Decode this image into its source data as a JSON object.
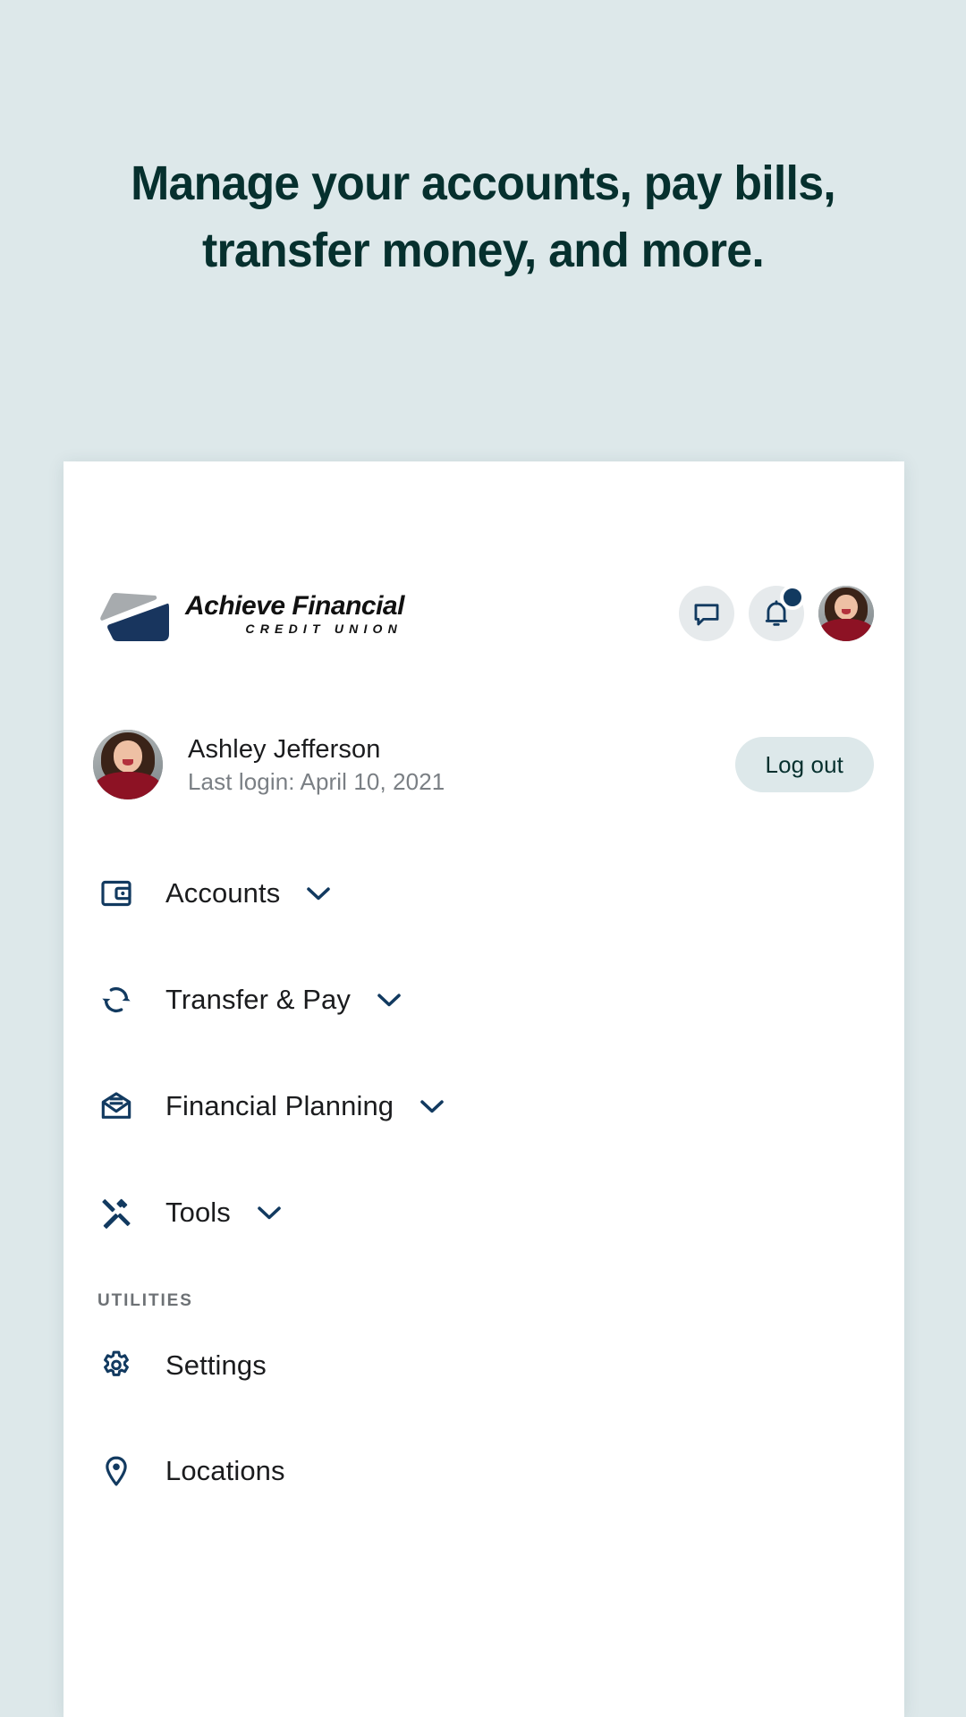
{
  "page": {
    "background_color": "#dde8ea",
    "headline_color": "#06302e",
    "accent_navy": "#123a60",
    "headline_line1": "Manage your accounts, pay bills,",
    "headline_line2": "transfer money, and more."
  },
  "card": {
    "background_color": "#ffffff",
    "brand": {
      "name": "Achieve Financial",
      "subtitle": "CREDIT UNION",
      "mark_gray": "#a7abae",
      "mark_navy": "#18355e"
    },
    "header_actions": [
      {
        "name": "messages-button",
        "icon": "chat-bubble-icon"
      },
      {
        "name": "notifications-button",
        "icon": "bell-icon",
        "has_badge": true
      },
      {
        "name": "profile-avatar-button",
        "icon": "avatar"
      }
    ],
    "user": {
      "name": "Ashley Jefferson",
      "last_login": "Last login: April 10, 2021",
      "logout_label": "Log out",
      "logout_bg": "#dde8ea"
    },
    "nav": {
      "items": [
        {
          "label": "Accounts",
          "icon": "wallet-icon",
          "has_caret": true
        },
        {
          "label": "Transfer & Pay",
          "icon": "sync-arrows-icon",
          "has_caret": true
        },
        {
          "label": "Financial Planning",
          "icon": "open-envelope-icon",
          "has_caret": true
        },
        {
          "label": "Tools",
          "icon": "hammer-screwdriver-icon",
          "has_caret": true
        }
      ],
      "utilities_title": "UTILITIES",
      "utilities": [
        {
          "label": "Settings",
          "icon": "gear-icon",
          "has_caret": false
        },
        {
          "label": "Locations",
          "icon": "map-pin-icon",
          "has_caret": false
        }
      ]
    }
  }
}
